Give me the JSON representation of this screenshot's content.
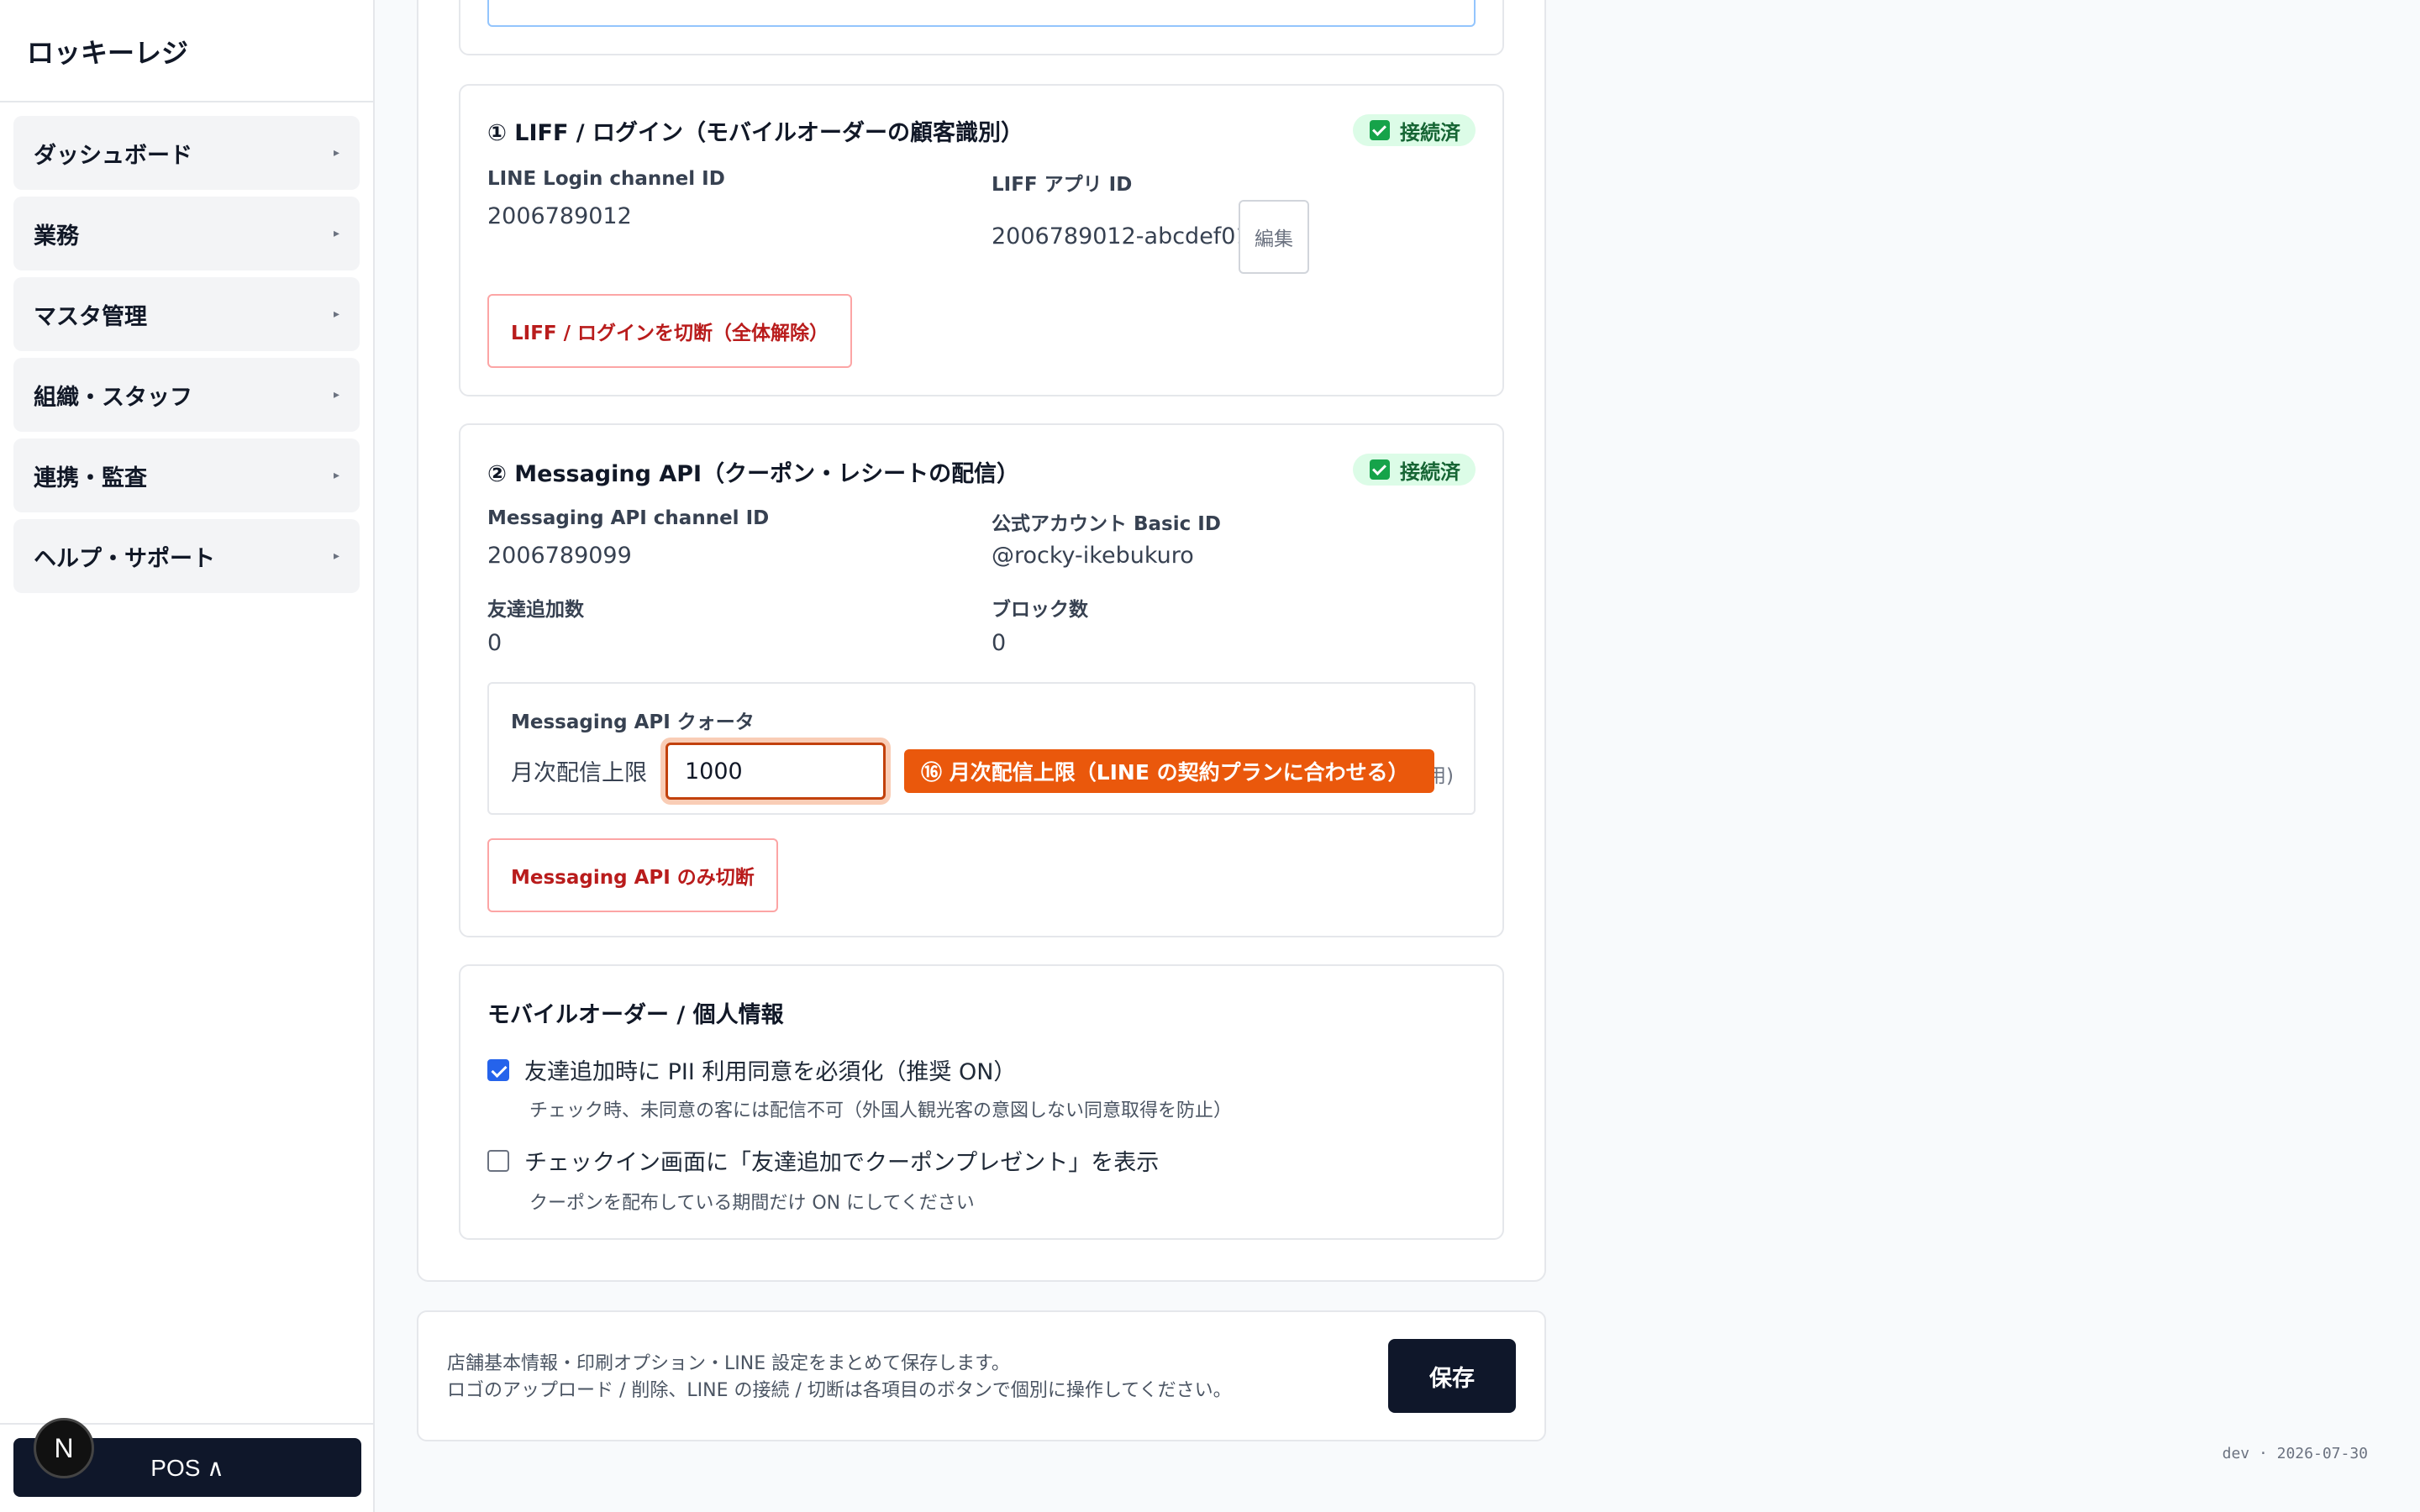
{
  "app": {
    "title": "ロッキーレジ"
  },
  "sidebar": {
    "items": [
      {
        "label": "ダッシュボード"
      },
      {
        "label": "業務"
      },
      {
        "label": "マスタ管理"
      },
      {
        "label": "組織・スタッフ"
      },
      {
        "label": "連携・監査"
      },
      {
        "label": "ヘルプ・サポート"
      }
    ],
    "pos_label": "POS ∧",
    "n_badge": "N"
  },
  "liff": {
    "title": "① LIFF / ログイン（モバイルオーダーの顧客識別）",
    "status": "接続済",
    "login_channel_label": "LINE Login channel ID",
    "login_channel_value": "2006789012",
    "liff_app_label": "LIFF アプリ ID",
    "liff_app_value": "2006789012-abcdef01",
    "edit_label": "編集",
    "disconnect_label": "LIFF / ログインを切断（全体解除）"
  },
  "messaging": {
    "title": "② Messaging API（クーポン・レシートの配信）",
    "status": "接続済",
    "channel_label": "Messaging API channel ID",
    "channel_value": "2006789099",
    "basic_id_label": "公式アカウント Basic ID",
    "basic_id_value": "@rocky-ikebukuro",
    "friends_label": "友達追加数",
    "friends_value": "0",
    "blocks_label": "ブロック数",
    "blocks_value": "0",
    "quota_title": "Messaging API クォータ",
    "quota_label": "月次配信上限",
    "quota_value": "1000",
    "quota_tip": "⑯ 月次配信上限（LINE の契約プランに合わせる）",
    "quota_usage": "% 使用)",
    "disconnect_label": "Messaging API のみ切断"
  },
  "mobile": {
    "title": "モバイルオーダー / 個人情報",
    "pii_label": "友達追加時に PII 利用同意を必須化（推奨 ON）",
    "pii_help": "チェック時、未同意の客には配信不可（外国人観光客の意図しない同意取得を防止）",
    "pii_checked": true,
    "checkin_label": "チェックイン画面に「友達追加でクーポンプレゼント」を表示",
    "checkin_help": "クーポンを配布している期間だけ ON にしてください",
    "checkin_checked": false
  },
  "footer": {
    "line1": "店舗基本情報・印刷オプション・LINE 設定をまとめて保存します。",
    "line2": "ロゴのアップロード / 削除、LINE の接続 / 切断は各項目のボタンで個別に操作してください。",
    "save_label": "保存"
  },
  "dev_label": "dev · 2026-07-30",
  "colors": {
    "accent": "#ea580c",
    "success": "#16a34a",
    "danger": "#b91c1c",
    "primary_dark": "#0f172a"
  }
}
